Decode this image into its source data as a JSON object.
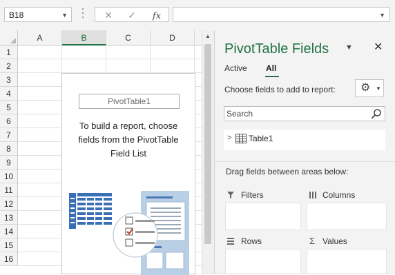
{
  "formula_bar": {
    "name_box": "B18",
    "cancel_symbol": "✕",
    "enter_symbol": "✓",
    "fx_label": "fx",
    "formula": ""
  },
  "sheet": {
    "columns": [
      "A",
      "B",
      "C",
      "D"
    ],
    "selected_column": "B",
    "rows": [
      "1",
      "2",
      "3",
      "4",
      "5",
      "6",
      "7",
      "8",
      "9",
      "10",
      "11",
      "12",
      "13",
      "14",
      "15",
      "16"
    ]
  },
  "pivot_placeholder": {
    "name": "PivotTable1",
    "instructions": "To build a report, choose fields from the PivotTable Field List"
  },
  "pane": {
    "title": "PivotTable Fields",
    "tabs": [
      {
        "label": "Active",
        "selected": false
      },
      {
        "label": "All",
        "selected": true
      }
    ],
    "choose_label": "Choose fields to add to report:",
    "search_placeholder": "Search",
    "fields": [
      {
        "label": "Table1",
        "icon": "table-icon"
      }
    ],
    "drag_label": "Drag fields between areas below:",
    "areas": [
      {
        "label": "Filters",
        "icon": "filter-icon"
      },
      {
        "label": "Columns",
        "icon": "columns-icon"
      },
      {
        "label": "Rows",
        "icon": "rows-icon"
      },
      {
        "label": "Values",
        "icon": "sigma-icon"
      }
    ]
  },
  "colors": {
    "accent_green": "#217346",
    "illustration_blue": "#3a6fb5",
    "checkmark_red": "#c0392b"
  }
}
